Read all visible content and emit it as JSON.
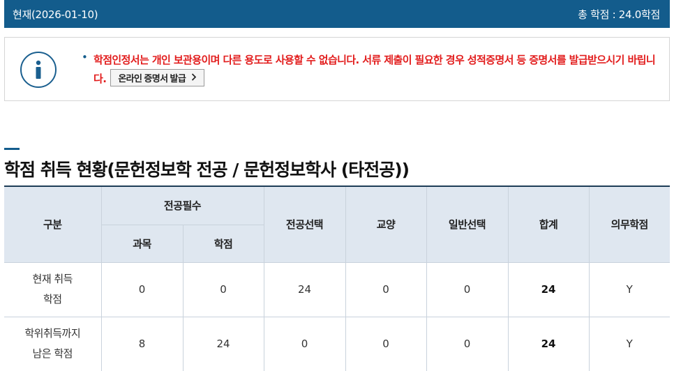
{
  "header": {
    "current_label": "현재(2026-01-10)",
    "total_credits": "총 학점 : 24.0학점"
  },
  "notice": {
    "icon": "info-icon",
    "bullet": "•",
    "message": "학점인정서는 개인 보관용이며 다른 용도로 사용할 수 없습니다. 서류 제출이 필요한 경우 성적증명서 등 증명서를 발급받으시기 바립니다.",
    "button_label": "온라인 증명서 발급",
    "button_icon": "chevron-right-icon",
    "colors": {
      "message": "#e21c1c",
      "bar": "#135c8c"
    }
  },
  "section": {
    "title": "학점 취득 현황(문헌정보학 전공 / 문헌정보학사 (타전공))"
  },
  "table": {
    "headers": {
      "category": "구분",
      "major_required": "전공필수",
      "courses": "과목",
      "credits": "학점",
      "major_elective": "전공선택",
      "liberal_arts": "교양",
      "general_elective": "일반선택",
      "total": "합계",
      "mandatory_credits": "의무학점"
    },
    "rows": [
      {
        "label_line1": "현재 취득",
        "label_line2": "학점",
        "courses": "0",
        "credits": "0",
        "major_elective": "24",
        "liberal_arts": "0",
        "general_elective": "0",
        "total": "24",
        "mandatory": "Y"
      },
      {
        "label_line1": "학위취득까지",
        "label_line2": "남은 학점",
        "courses": "8",
        "credits": "24",
        "major_elective": "0",
        "liberal_arts": "0",
        "general_elective": "0",
        "total": "24",
        "mandatory": "Y"
      }
    ]
  }
}
